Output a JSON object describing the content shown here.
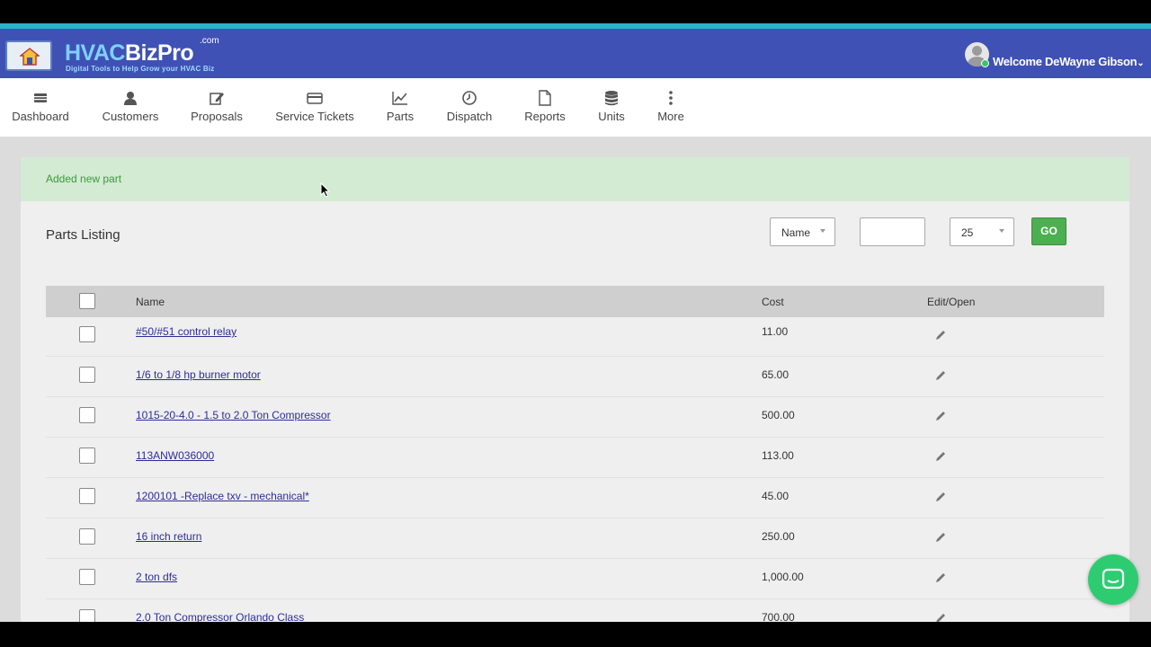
{
  "brand": {
    "name_part1": "HVAC",
    "name_part2": "BizPro",
    "domain_suffix": ".com",
    "tagline": "Digital Tools to Help Grow your HVAC Biz"
  },
  "user": {
    "welcome": "Welcome DeWayne Gibson",
    "status_color": "#3ac46a"
  },
  "nav": [
    {
      "label": "Dashboard",
      "icon": "dashboard-icon"
    },
    {
      "label": "Customers",
      "icon": "user-icon"
    },
    {
      "label": "Proposals",
      "icon": "edit-icon"
    },
    {
      "label": "Service Tickets",
      "icon": "credit-card-icon"
    },
    {
      "label": "Parts",
      "icon": "line-chart-icon"
    },
    {
      "label": "Dispatch",
      "icon": "clock-icon"
    },
    {
      "label": "Reports",
      "icon": "document-icon"
    },
    {
      "label": "Units",
      "icon": "database-icon"
    },
    {
      "label": "More",
      "icon": "more-vertical-icon"
    }
  ],
  "alert": {
    "message": "Added new part"
  },
  "listing": {
    "title": "Parts Listing",
    "sort_by": "Name",
    "search_value": "",
    "per_page": "25",
    "go_label": "GO"
  },
  "table": {
    "columns": {
      "name": "Name",
      "cost": "Cost",
      "edit": "Edit/Open"
    },
    "rows": [
      {
        "name": "#50/#51 control relay",
        "cost": "11.00"
      },
      {
        "name": "1/6 to 1/8 hp burner motor",
        "cost": "65.00"
      },
      {
        "name": "1015-20-4.0 - 1.5 to 2.0 Ton Compressor",
        "cost": "500.00"
      },
      {
        "name": "113ANW036000",
        "cost": "113.00"
      },
      {
        "name": "1200101 -Replace txv - mechanical*",
        "cost": "45.00"
      },
      {
        "name": "16 inch return",
        "cost": "250.00"
      },
      {
        "name": "2 ton dfs",
        "cost": "1,000.00"
      },
      {
        "name": "2.0 Ton Compressor Orlando Class",
        "cost": "700.00"
      }
    ]
  },
  "colors": {
    "header": "#3f51b5",
    "accent": "#2ab3c8",
    "success": "#4caf50",
    "chat": "#2ecc71"
  }
}
